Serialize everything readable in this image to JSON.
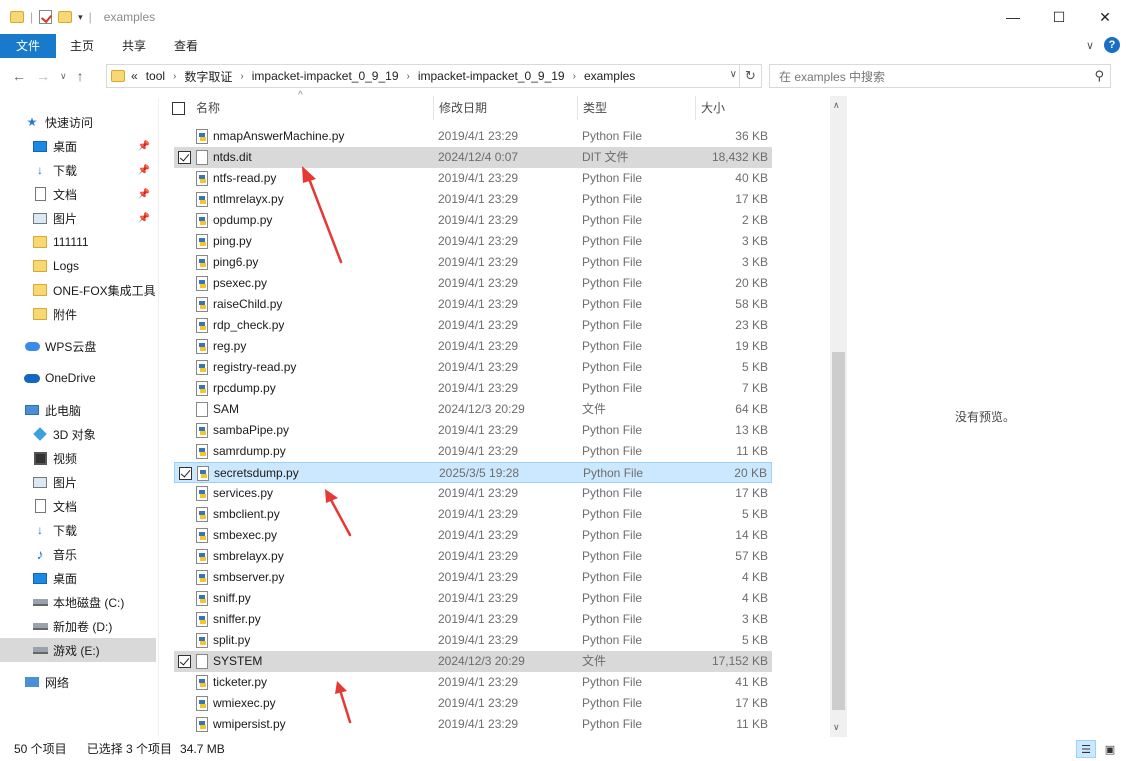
{
  "window": {
    "title": "examples",
    "controls": {
      "minimize": "—",
      "maximize": "☐",
      "close": "✕"
    }
  },
  "ribbon": {
    "tabs": [
      "文件",
      "主页",
      "共享",
      "查看"
    ],
    "expand_icon": "∨",
    "help": "?"
  },
  "nav": {
    "back": "←",
    "forward": "→",
    "recent": "∨",
    "up": "↑"
  },
  "address": {
    "prefix": "«",
    "crumbs": [
      "tool",
      "数字取证",
      "impacket-impacket_0_9_19",
      "impacket-impacket_0_9_19",
      "examples"
    ]
  },
  "search": {
    "placeholder": "在 examples 中搜索"
  },
  "sidebar": {
    "items": [
      {
        "label": "快速访问",
        "icon": "star-icon"
      },
      {
        "label": "桌面",
        "icon": "desktop-icon",
        "pinned": true
      },
      {
        "label": "下载",
        "icon": "download-icon",
        "pinned": true
      },
      {
        "label": "文档",
        "icon": "document-icon",
        "pinned": true
      },
      {
        "label": "图片",
        "icon": "picture-icon",
        "pinned": true
      },
      {
        "label": "111111",
        "icon": "folder-icon"
      },
      {
        "label": "Logs",
        "icon": "folder-icon"
      },
      {
        "label": "ONE-FOX集成工具",
        "icon": "folder-icon"
      },
      {
        "label": "附件",
        "icon": "folder-icon"
      },
      {
        "label": "WPS云盘",
        "icon": "cloud-icon"
      },
      {
        "label": "OneDrive",
        "icon": "onedrive-icon"
      },
      {
        "label": "此电脑",
        "icon": "pc-icon"
      },
      {
        "label": "3D 对象",
        "icon": "3d-objects-icon"
      },
      {
        "label": "视频",
        "icon": "video-icon"
      },
      {
        "label": "图片",
        "icon": "picture-icon"
      },
      {
        "label": "文档",
        "icon": "document-icon"
      },
      {
        "label": "下载",
        "icon": "download-icon"
      },
      {
        "label": "音乐",
        "icon": "music-icon"
      },
      {
        "label": "桌面",
        "icon": "desktop-icon"
      },
      {
        "label": "本地磁盘 (C:)",
        "icon": "drive-icon"
      },
      {
        "label": "新加卷 (D:)",
        "icon": "drive-icon"
      },
      {
        "label": "游戏 (E:)",
        "icon": "drive-icon"
      },
      {
        "label": "网络",
        "icon": "network-icon"
      }
    ]
  },
  "columns": {
    "name": "名称",
    "date": "修改日期",
    "type": "类型",
    "size": "大小"
  },
  "files": [
    {
      "name": "nmapAnswerMachine.py",
      "date": "2019/4/1 23:29",
      "type": "Python File",
      "size": "36 KB",
      "kind": "py",
      "checked": false
    },
    {
      "name": "ntds.dit",
      "date": "2024/12/4 0:07",
      "type": "DIT 文件",
      "size": "18,432 KB",
      "kind": "file",
      "checked": true
    },
    {
      "name": "ntfs-read.py",
      "date": "2019/4/1 23:29",
      "type": "Python File",
      "size": "40 KB",
      "kind": "py",
      "checked": false
    },
    {
      "name": "ntlmrelayx.py",
      "date": "2019/4/1 23:29",
      "type": "Python File",
      "size": "17 KB",
      "kind": "py",
      "checked": false
    },
    {
      "name": "opdump.py",
      "date": "2019/4/1 23:29",
      "type": "Python File",
      "size": "2 KB",
      "kind": "py",
      "checked": false
    },
    {
      "name": "ping.py",
      "date": "2019/4/1 23:29",
      "type": "Python File",
      "size": "3 KB",
      "kind": "py",
      "checked": false
    },
    {
      "name": "ping6.py",
      "date": "2019/4/1 23:29",
      "type": "Python File",
      "size": "3 KB",
      "kind": "py",
      "checked": false
    },
    {
      "name": "psexec.py",
      "date": "2019/4/1 23:29",
      "type": "Python File",
      "size": "20 KB",
      "kind": "py",
      "checked": false
    },
    {
      "name": "raiseChild.py",
      "date": "2019/4/1 23:29",
      "type": "Python File",
      "size": "58 KB",
      "kind": "py",
      "checked": false
    },
    {
      "name": "rdp_check.py",
      "date": "2019/4/1 23:29",
      "type": "Python File",
      "size": "23 KB",
      "kind": "py",
      "checked": false
    },
    {
      "name": "reg.py",
      "date": "2019/4/1 23:29",
      "type": "Python File",
      "size": "19 KB",
      "kind": "py",
      "checked": false
    },
    {
      "name": "registry-read.py",
      "date": "2019/4/1 23:29",
      "type": "Python File",
      "size": "5 KB",
      "kind": "py",
      "checked": false
    },
    {
      "name": "rpcdump.py",
      "date": "2019/4/1 23:29",
      "type": "Python File",
      "size": "7 KB",
      "kind": "py",
      "checked": false
    },
    {
      "name": "SAM",
      "date": "2024/12/3 20:29",
      "type": "文件",
      "size": "64 KB",
      "kind": "file",
      "checked": false
    },
    {
      "name": "sambaPipe.py",
      "date": "2019/4/1 23:29",
      "type": "Python File",
      "size": "13 KB",
      "kind": "py",
      "checked": false
    },
    {
      "name": "samrdump.py",
      "date": "2019/4/1 23:29",
      "type": "Python File",
      "size": "11 KB",
      "kind": "py",
      "checked": false
    },
    {
      "name": "secretsdump.py",
      "date": "2025/3/5 19:28",
      "type": "Python File",
      "size": "20 KB",
      "kind": "py",
      "checked": true
    },
    {
      "name": "services.py",
      "date": "2019/4/1 23:29",
      "type": "Python File",
      "size": "17 KB",
      "kind": "py",
      "checked": false
    },
    {
      "name": "smbclient.py",
      "date": "2019/4/1 23:29",
      "type": "Python File",
      "size": "5 KB",
      "kind": "py",
      "checked": false
    },
    {
      "name": "smbexec.py",
      "date": "2019/4/1 23:29",
      "type": "Python File",
      "size": "14 KB",
      "kind": "py",
      "checked": false
    },
    {
      "name": "smbrelayx.py",
      "date": "2019/4/1 23:29",
      "type": "Python File",
      "size": "57 KB",
      "kind": "py",
      "checked": false
    },
    {
      "name": "smbserver.py",
      "date": "2019/4/1 23:29",
      "type": "Python File",
      "size": "4 KB",
      "kind": "py",
      "checked": false
    },
    {
      "name": "sniff.py",
      "date": "2019/4/1 23:29",
      "type": "Python File",
      "size": "4 KB",
      "kind": "py",
      "checked": false
    },
    {
      "name": "sniffer.py",
      "date": "2019/4/1 23:29",
      "type": "Python File",
      "size": "3 KB",
      "kind": "py",
      "checked": false
    },
    {
      "name": "split.py",
      "date": "2019/4/1 23:29",
      "type": "Python File",
      "size": "5 KB",
      "kind": "py",
      "checked": false
    },
    {
      "name": "SYSTEM",
      "date": "2024/12/3 20:29",
      "type": "文件",
      "size": "17,152 KB",
      "kind": "file",
      "checked": true
    },
    {
      "name": "ticketer.py",
      "date": "2019/4/1 23:29",
      "type": "Python File",
      "size": "41 KB",
      "kind": "py",
      "checked": false
    },
    {
      "name": "wmiexec.py",
      "date": "2019/4/1 23:29",
      "type": "Python File",
      "size": "17 KB",
      "kind": "py",
      "checked": false
    },
    {
      "name": "wmipersist.py",
      "date": "2019/4/1 23:29",
      "type": "Python File",
      "size": "11 KB",
      "kind": "py",
      "checked": false
    }
  ],
  "preview": {
    "text": "没有预览。"
  },
  "status": {
    "count": "50 个项目",
    "selected": "已选择 3 个项目",
    "size": "34.7 MB"
  },
  "colors": {
    "accent": "#1979ca",
    "annotation": "#e53935",
    "selection": "#cce8ff"
  }
}
